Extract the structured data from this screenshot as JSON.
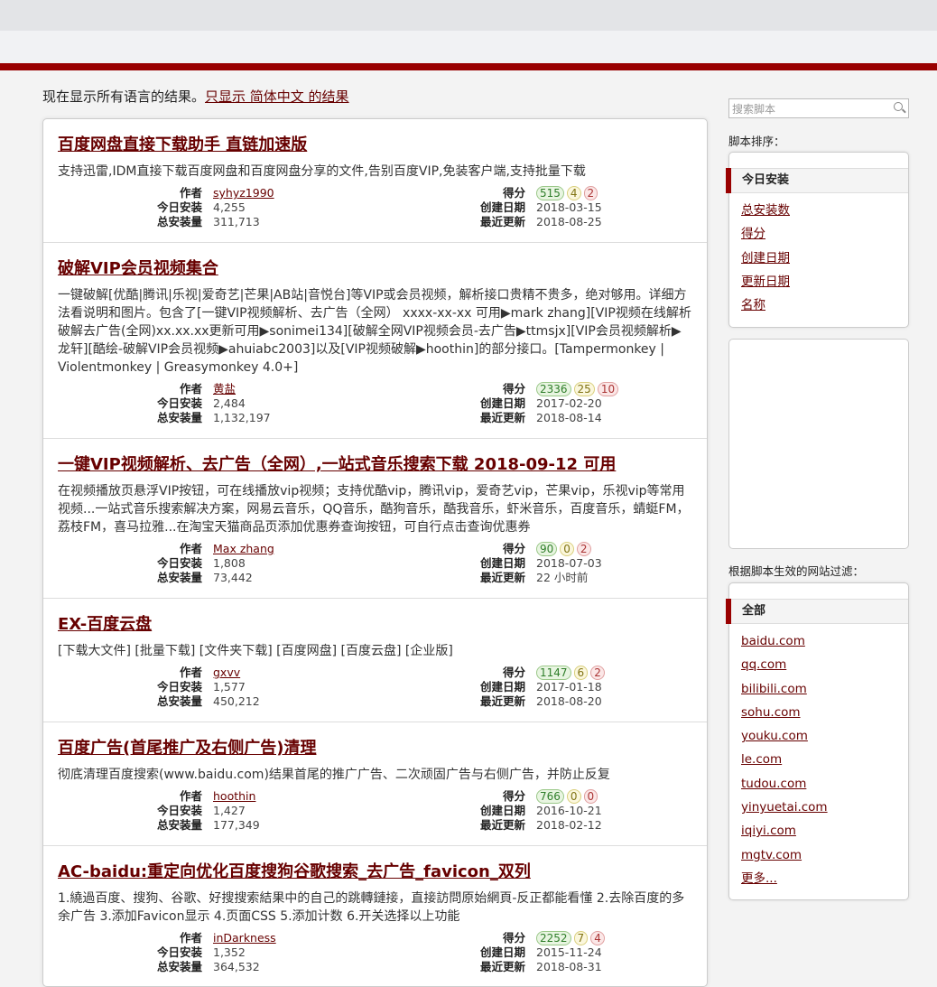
{
  "lang_note": {
    "prefix": "现在显示所有语言的结果。",
    "link": "只显示 简体中文 的结果"
  },
  "labels": {
    "author": "作者",
    "daily": "今日安装",
    "total": "总安装量",
    "score": "得分",
    "created": "创建日期",
    "updated": "最近更新"
  },
  "scripts": [
    {
      "title": "百度网盘直接下载助手 直链加速版",
      "desc": "支持迅雷,IDM直接下载百度网盘和百度网盘分享的文件,告别百度VIP,免装客户端,支持批量下载",
      "author": "syhyz1990",
      "daily": "4,255",
      "total": "311,713",
      "good": "515",
      "ok": "4",
      "bad": "2",
      "created": "2018-03-15",
      "updated": "2018-08-25"
    },
    {
      "title": "破解VIP会员视频集合",
      "desc": "一键破解[优酷|腾讯|乐视|爱奇艺|芒果|AB站|音悦台]等VIP或会员视频，解析接口贵精不贵多，绝对够用。详细方法看说明和图片。包含了[一键VIP视频解析、去广告（全网） xxxx-xx-xx 可用▶mark zhang][VIP视频在线解析破解去广告(全网)xx.xx.xx更新可用▶sonimei134][破解全网VIP视频会员-去广告▶ttmsjx][VIP会员视频解析▶龙轩][酷绘-破解VIP会员视频▶ahuiabc2003]以及[VIP视频破解▶hoothin]的部分接口。[Tampermonkey | Violentmonkey | Greasymonkey 4.0+]",
      "author": "黄盐",
      "daily": "2,484",
      "total": "1,132,197",
      "good": "2336",
      "ok": "25",
      "bad": "10",
      "created": "2017-02-20",
      "updated": "2018-08-14"
    },
    {
      "title": "一键VIP视频解析、去广告（全网）,一站式音乐搜索下载 2018-09-12 可用",
      "desc": "在视频播放页悬浮VIP按钮，可在线播放vip视频；支持优酷vip，腾讯vip，爱奇艺vip，芒果vip，乐视vip等常用视频...一站式音乐搜索解决方案，网易云音乐，QQ音乐，酷狗音乐，酷我音乐，虾米音乐，百度音乐，蜻蜓FM，荔枝FM，喜马拉雅...在淘宝天猫商品页添加优惠券查询按钮，可自行点击查询优惠券",
      "author": "Max zhang",
      "daily": "1,808",
      "total": "73,442",
      "good": "90",
      "ok": "0",
      "bad": "2",
      "created": "2018-07-03",
      "updated": "22 小时前"
    },
    {
      "title": "EX-百度云盘",
      "desc": "[下载大文件] [批量下载] [文件夹下载] [百度网盘] [百度云盘] [企业版]",
      "author": "gxvv",
      "daily": "1,577",
      "total": "450,212",
      "good": "1147",
      "ok": "6",
      "bad": "2",
      "created": "2017-01-18",
      "updated": "2018-08-20"
    },
    {
      "title": "百度广告(首尾推广及右侧广告)清理",
      "desc": "彻底清理百度搜索(www.baidu.com)结果首尾的推广广告、二次顽固广告与右侧广告，并防止反复",
      "author": "hoothin",
      "daily": "1,427",
      "total": "177,349",
      "good": "766",
      "ok": "0",
      "bad": "0",
      "created": "2016-10-21",
      "updated": "2018-02-12"
    },
    {
      "title": "AC-baidu:重定向优化百度搜狗谷歌搜索_去广告_favicon_双列",
      "desc": "1.繞過百度、搜狗、谷歌、好搜搜索結果中的自己的跳轉鏈接，直接訪問原始網頁-反正都能看懂 2.去除百度的多余广告 3.添加Favicon显示 4.页面CSS 5.添加计数 6.开关选择以上功能",
      "author": "inDarkness",
      "daily": "1,352",
      "total": "364,532",
      "good": "2252",
      "ok": "7",
      "bad": "4",
      "created": "2015-11-24",
      "updated": "2018-08-31"
    }
  ],
  "sidebar": {
    "search_placeholder": "搜索脚本",
    "sort_label": "脚本排序：",
    "sort_active": "今日安装",
    "sort_options": [
      "总安装数",
      "得分",
      "创建日期",
      "更新日期",
      "名称"
    ],
    "filter_label": "根据脚本生效的网站过滤：",
    "filter_active": "全部",
    "sites": [
      "baidu.com",
      "qq.com",
      "bilibili.com",
      "sohu.com",
      "youku.com",
      "le.com",
      "tudou.com",
      "yinyuetai.com",
      "iqiyi.com",
      "mgtv.com",
      "更多..."
    ]
  }
}
